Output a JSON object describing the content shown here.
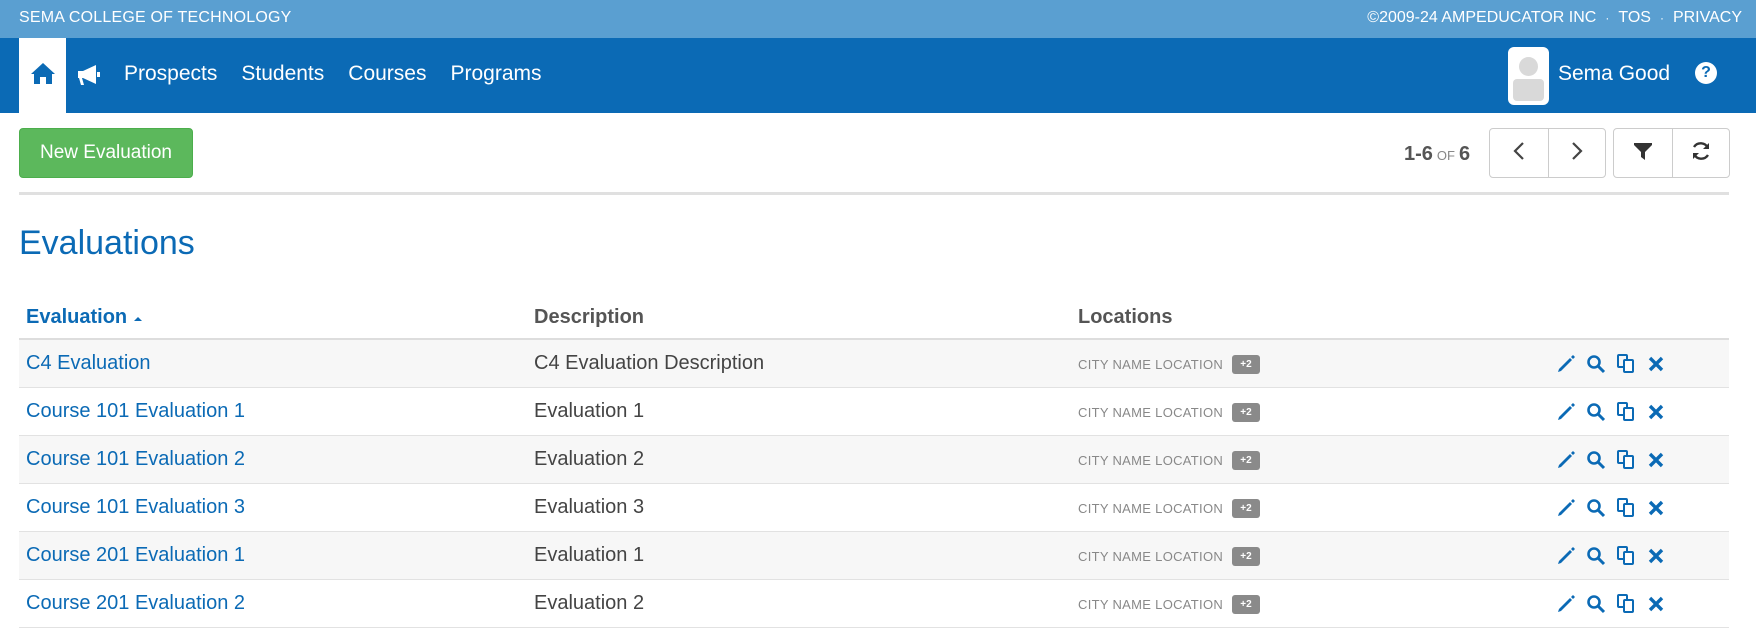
{
  "topbar": {
    "school": "SEMA COLLEGE OF TECHNOLOGY",
    "copyright": "©2009-24 AMPEDUCATOR INC",
    "tos": "TOS",
    "privacy": "PRIVACY",
    "separator": "·"
  },
  "nav": {
    "items": [
      "Prospects",
      "Students",
      "Courses",
      "Programs"
    ],
    "user_name": "Sema Good",
    "help_glyph": "?"
  },
  "toolbar": {
    "new_button": "New Evaluation",
    "range": "1-6",
    "of": "OF",
    "total": "6"
  },
  "page": {
    "title": "Evaluations"
  },
  "table": {
    "headers": {
      "evaluation": "Evaluation",
      "description": "Description",
      "locations": "Locations"
    },
    "rows": [
      {
        "name": "C4 Evaluation",
        "description": "C4 Evaluation Description",
        "location": "CITY NAME LOCATION",
        "extra": "+2"
      },
      {
        "name": "Course 101 Evaluation 1",
        "description": "Evaluation 1",
        "location": "CITY NAME LOCATION",
        "extra": "+2"
      },
      {
        "name": "Course 101 Evaluation 2",
        "description": "Evaluation 2",
        "location": "CITY NAME LOCATION",
        "extra": "+2"
      },
      {
        "name": "Course 101 Evaluation 3",
        "description": "Evaluation 3",
        "location": "CITY NAME LOCATION",
        "extra": "+2"
      },
      {
        "name": "Course 201 Evaluation 1",
        "description": "Evaluation 1",
        "location": "CITY NAME LOCATION",
        "extra": "+2"
      },
      {
        "name": "Course 201 Evaluation 2",
        "description": "Evaluation 2",
        "location": "CITY NAME LOCATION",
        "extra": "+2"
      }
    ]
  },
  "colors": {
    "top_bar": "#5a9fd1",
    "nav_bar": "#0b6ab5",
    "accent": "#0b6ab5",
    "new_button": "#5cb85c"
  },
  "icons": [
    "home-icon",
    "megaphone-icon",
    "help-icon",
    "chevron-left-icon",
    "chevron-right-icon",
    "filter-icon",
    "refresh-icon",
    "edit-icon",
    "search-icon",
    "copy-icon",
    "delete-icon"
  ]
}
